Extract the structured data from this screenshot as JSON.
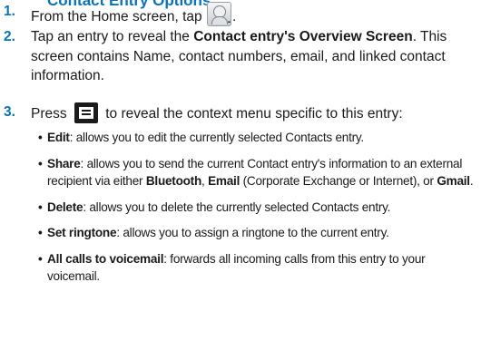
{
  "section_heading": "Contact Entry Options",
  "steps": [
    {
      "number": "1.",
      "text_before": "From the Home screen, tap",
      "icon": "contacts-icon",
      "text_after": "."
    },
    {
      "number": "2.",
      "text_before": "Tap an entry to reveal the ",
      "bold": "Contact entry's Overview Screen",
      "text_after": ". This screen contains Name, contact numbers, email, and linked contact information."
    },
    {
      "number": "3.",
      "text_before": "Press",
      "icon": "menu-key-icon",
      "text_after": "to reveal the context menu specific to this entry:"
    }
  ],
  "menu_options": [
    {
      "term": "Edit",
      "desc": ": allows you to edit the currently selected Contacts entry."
    },
    {
      "term": "Share",
      "desc_1": ": allows you to send the current Contact entry's information to an external recipient via either ",
      "bold_1": "Bluetooth",
      "desc_2": ", ",
      "bold_2": "Email",
      "desc_3": " (Corporate Exchange or Internet), or ",
      "bold_3": "Gmail",
      "desc_4": "."
    },
    {
      "term": "Delete",
      "desc": ": allows you to delete the currently selected Contacts entry."
    },
    {
      "term": "Set ringtone",
      "desc": ": allows you to assign a ringtone to the current entry."
    },
    {
      "term": "All calls to voicemail",
      "desc": ": forwards all incoming calls from this entry to your voicemail."
    }
  ],
  "colors": {
    "accent": "#0a72b7",
    "text": "#1a1a1a",
    "menu_key": "#1b1b1b"
  }
}
